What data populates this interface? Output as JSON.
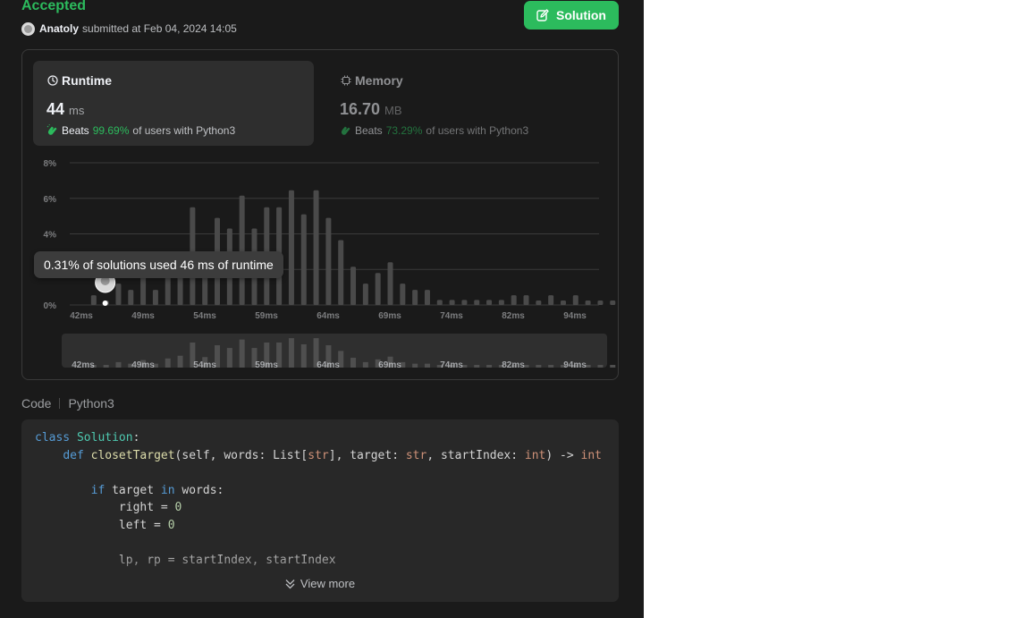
{
  "header": {
    "status": "Accepted",
    "submitter_name": "Anatoly",
    "submitted_text": "submitted at Feb 04, 2024 14:05",
    "solution_button_label": "Solution"
  },
  "metrics": {
    "runtime": {
      "label": "Runtime",
      "value": "44",
      "unit": "ms",
      "beats_word": "Beats",
      "beats_pct": "99.69%",
      "beats_suffix": "of users with Python3"
    },
    "memory": {
      "label": "Memory",
      "value": "16.70",
      "unit": "MB",
      "beats_word": "Beats",
      "beats_pct": "73.29%",
      "beats_suffix": "of users with Python3"
    }
  },
  "tooltip": {
    "text": "0.31% of solutions used 46 ms of runtime"
  },
  "colors": {
    "accent_green": "#2cbb5d",
    "bar": "#4a4a4a",
    "background": "#1a1a1a"
  },
  "chart_data": {
    "type": "bar",
    "title": "",
    "xlabel": "",
    "ylabel": "",
    "y_ticks": [
      "0%",
      "2%",
      "4%",
      "6%",
      "8%"
    ],
    "ylim": [
      0,
      8
    ],
    "x_tick_labels": [
      "42ms",
      "49ms",
      "54ms",
      "59ms",
      "64ms",
      "69ms",
      "74ms",
      "82ms",
      "94ms"
    ],
    "x_tick_at": [
      42,
      49,
      54,
      59,
      64,
      69,
      74,
      82,
      94
    ],
    "grid": true,
    "highlight_x": 44,
    "x": [
      43,
      44,
      45,
      46,
      47,
      48,
      49,
      50,
      51,
      52,
      53,
      54,
      55,
      56,
      57,
      58,
      59,
      60,
      61,
      62,
      63,
      64,
      65,
      66,
      67,
      68,
      69,
      70,
      71,
      72,
      73,
      74,
      75,
      76,
      77,
      78,
      79,
      80,
      81,
      82,
      83,
      84,
      85,
      86
    ],
    "values": [
      0.55,
      0.25,
      1.2,
      0.85,
      1.65,
      0.85,
      2.0,
      2.6,
      5.5,
      2.3,
      4.9,
      4.3,
      6.15,
      4.3,
      5.5,
      5.5,
      6.45,
      5.1,
      6.45,
      4.9,
      3.65,
      2.15,
      1.2,
      1.8,
      2.4,
      1.2,
      0.85,
      0.85,
      0.28,
      0.28,
      0.28,
      0.28,
      0.28,
      0.28,
      0.55,
      0.55,
      0.25,
      0.55,
      0.25,
      0.55,
      0.25,
      0.25,
      0.25,
      0.25
    ],
    "overview_x_tick_labels": [
      "42ms",
      "49ms",
      "54ms",
      "59ms",
      "64ms",
      "69ms",
      "74ms",
      "82ms",
      "94ms"
    ]
  },
  "code": {
    "header_label": "Code",
    "language": "Python3",
    "view_more_label": "View more",
    "lines": [
      [
        {
          "t": "class ",
          "c": "kw"
        },
        {
          "t": "Solution",
          "c": "cls"
        },
        {
          "t": ":",
          "c": ""
        }
      ],
      [
        {
          "t": "    ",
          "c": ""
        },
        {
          "t": "def ",
          "c": "kw"
        },
        {
          "t": "closetTarget",
          "c": "fn"
        },
        {
          "t": "(self, words: List[",
          "c": ""
        },
        {
          "t": "str",
          "c": "ty"
        },
        {
          "t": "], target: ",
          "c": ""
        },
        {
          "t": "str",
          "c": "ty"
        },
        {
          "t": ", startIndex: ",
          "c": ""
        },
        {
          "t": "int",
          "c": "ty"
        },
        {
          "t": ") -> ",
          "c": ""
        },
        {
          "t": "int",
          "c": "ty"
        }
      ],
      [],
      [
        {
          "t": "        ",
          "c": ""
        },
        {
          "t": "if ",
          "c": "kw"
        },
        {
          "t": "target ",
          "c": ""
        },
        {
          "t": "in ",
          "c": "kw"
        },
        {
          "t": "words:",
          "c": ""
        }
      ],
      [
        {
          "t": "            right = ",
          "c": ""
        },
        {
          "t": "0",
          "c": "num"
        }
      ],
      [
        {
          "t": "            left = ",
          "c": ""
        },
        {
          "t": "0",
          "c": "num"
        }
      ],
      [],
      [
        {
          "t": "            lp, rp = startIndex, startIndex",
          "c": ""
        }
      ]
    ]
  }
}
